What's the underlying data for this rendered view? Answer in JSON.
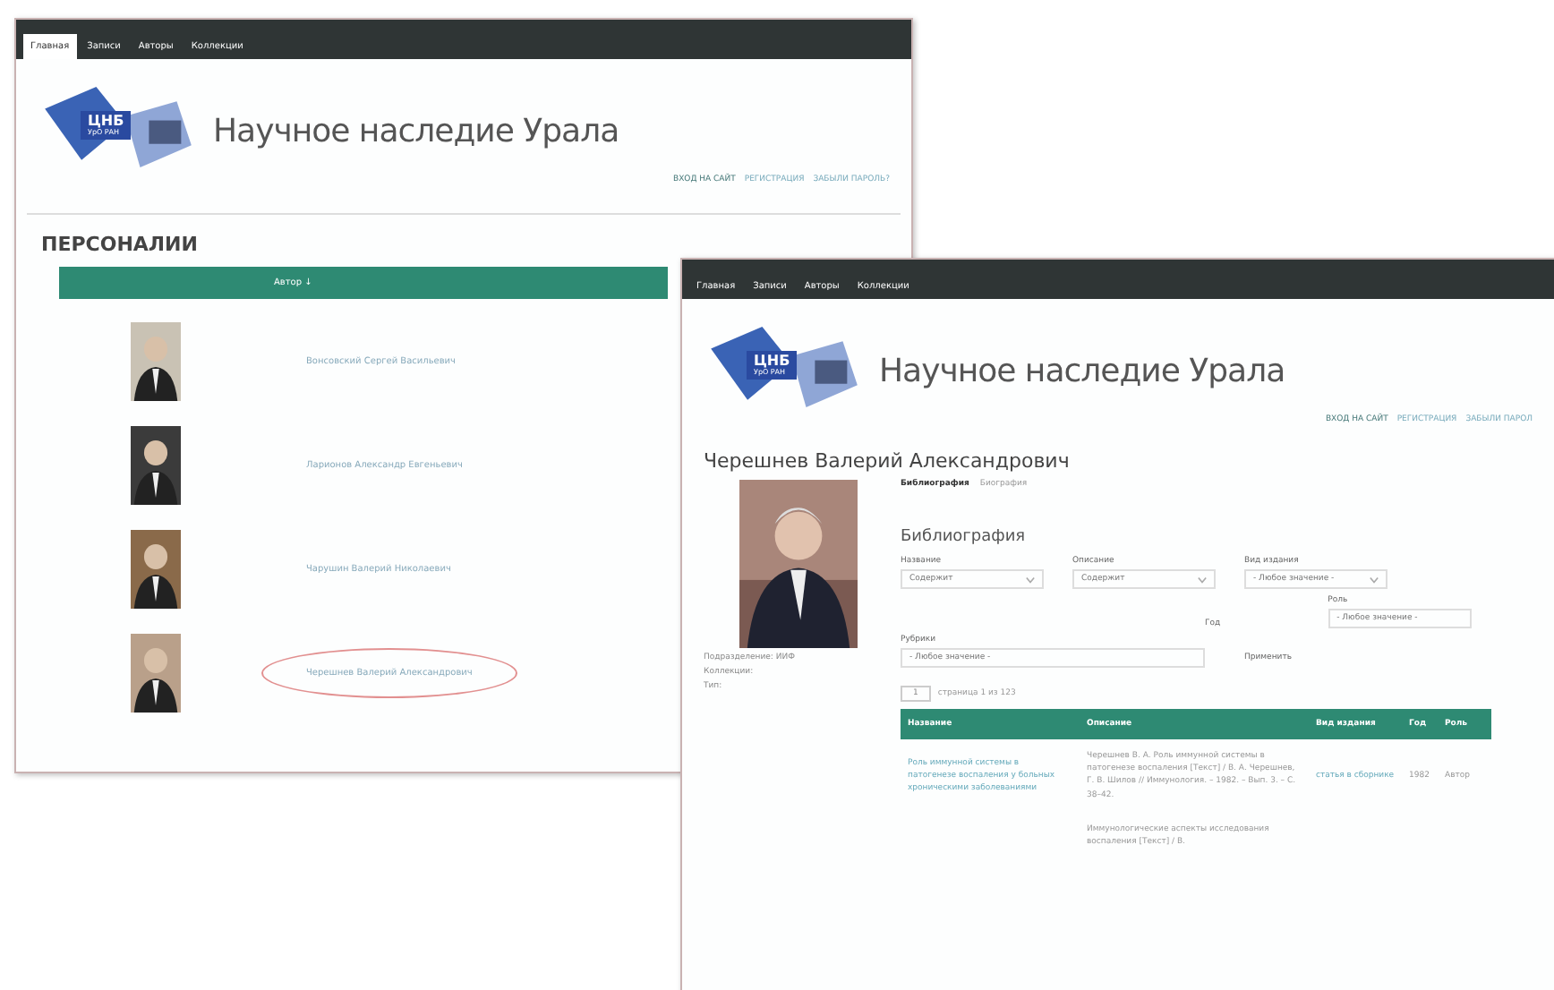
{
  "left_window": {
    "nav": [
      {
        "label": "Главная",
        "selected": true
      },
      {
        "label": "Записи",
        "selected": false
      },
      {
        "label": "Авторы",
        "selected": false
      },
      {
        "label": "Коллекции",
        "selected": false
      }
    ],
    "logo_text": "ЦНБ",
    "logo_subtext": "УрО РАН",
    "site_title": "Научное наследие Урала",
    "user_links": [
      "ВХОД НА САЙТ",
      "РЕГИСТРАЦИЯ",
      "ЗАБЫЛИ ПАРОЛЬ?"
    ],
    "heading": "ПЕРСОНАЛИИ",
    "table_header": "Автор ↓",
    "authors": [
      {
        "name": "Вонсовский Сергей Васильевич",
        "circled": false
      },
      {
        "name": "Ларионов Александр Евгеньевич",
        "circled": false
      },
      {
        "name": "Чарушин Валерий Николаевич",
        "circled": false
      },
      {
        "name": "Черешнев Валерий Александрович",
        "circled": true
      }
    ]
  },
  "right_window": {
    "nav": [
      {
        "label": "Главная",
        "selected": false
      },
      {
        "label": "Записи",
        "selected": false
      },
      {
        "label": "Авторы",
        "selected": false
      },
      {
        "label": "Коллекции",
        "selected": false
      }
    ],
    "logo_text": "ЦНБ",
    "logo_subtext": "УрО РАН",
    "site_title": "Научное наследие Урала",
    "user_links": [
      "ВХОД НА САЙТ",
      "РЕГИСТРАЦИЯ",
      "ЗАБЫЛИ ПАРОЛ"
    ],
    "person_name": "Черешнев Валерий Александрович",
    "info": [
      "Подразделение: ИИФ",
      "Коллекции:",
      "Тип:"
    ],
    "tabs": [
      {
        "label": "Библиография",
        "selected": true
      },
      {
        "label": "Биография",
        "selected": false
      }
    ],
    "section_title": "Библиография",
    "filters": [
      {
        "label": "Название",
        "value": "Содержит"
      },
      {
        "label": "Описание",
        "value": "Содержит"
      },
      {
        "label": "Вид издания",
        "value": "- Любое значение -"
      }
    ],
    "filters2": [
      {
        "label": "Год"
      },
      {
        "label": "Роль",
        "value": "- Любое значение -"
      }
    ],
    "rubric": {
      "label": "Рубрики",
      "value": "- Любое значение -"
    },
    "apply": "Применить",
    "pager": {
      "page": "1",
      "text": "страница 1 из 123"
    },
    "columns": [
      "Название",
      "Описание",
      "Вид издания",
      "Год",
      "Роль"
    ],
    "rows": [
      {
        "title": "Роль иммунной системы в патогенезе воспаления у больных хроническими заболеваниями",
        "description": "Черешнев В. А. Роль иммунной системы в патогенезе воспаления [Текст] / В. А. Черешнев, Г. В. Шилов // Иммунология. – 1982. – Вып. 3. – С. 38–42.",
        "kind": "статья в сборнике",
        "year": "1982",
        "role": "Автор"
      }
    ],
    "next_description": "Иммунологические аспекты исследования воспаления [Текст] / В."
  }
}
